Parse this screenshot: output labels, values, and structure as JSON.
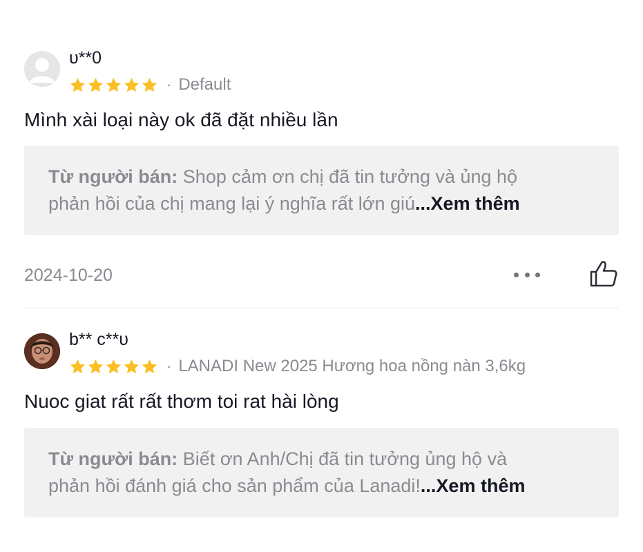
{
  "reviews": [
    {
      "username": "υ**0",
      "rating": 5,
      "separator": "·",
      "variant": "Default",
      "text": "Mình xài loại này ok đã đặt nhiều lần",
      "seller_reply": {
        "label": "Từ người bán:",
        "line1": "Shop cảm ơn chị đã tin tưởng và ủng hộ",
        "line2": "phản hồi của chị  mang lại ý nghĩa rất lớn giú",
        "see_more": "...Xem thêm"
      },
      "date": "2024-10-20",
      "avatar": "default-avatar-icon"
    },
    {
      "username": "b** c**υ",
      "rating": 5,
      "separator": "·",
      "variant": "LANADI New 2025 Hương hoa nồng nàn 3,6kg",
      "text": "Nuoc giat rất rất thơm toi rat hài lòng",
      "seller_reply": {
        "label": "Từ người bán:",
        "line1": "Biết ơn Anh/Chị đã tin tưởng ủng hộ và",
        "line2": "phản hồi đánh giá cho sản phẩm của Lanadi!",
        "see_more": "...Xem thêm"
      },
      "avatar": "user-photo-avatar"
    }
  ],
  "icons": {
    "star": "star-icon",
    "more": "more-options-icon",
    "like": "thumbs-up-icon"
  },
  "colors": {
    "star": "#fbbf24",
    "muted": "#8a8b91",
    "reply_bg": "#f1f1f2",
    "text": "#161823"
  }
}
